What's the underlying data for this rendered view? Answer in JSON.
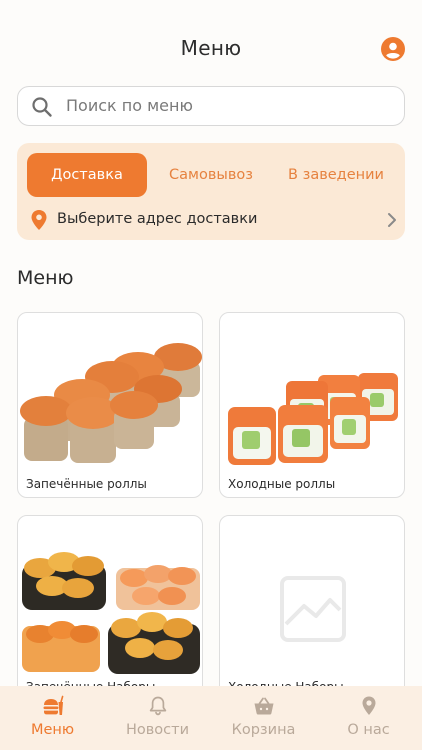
{
  "header": {
    "title": "Меню"
  },
  "search": {
    "placeholder": "Поиск по меню",
    "value": ""
  },
  "delivery": {
    "tabs": [
      {
        "label": "Доставка",
        "active": true
      },
      {
        "label": "Самовывоз",
        "active": false
      },
      {
        "label": "В заведении",
        "active": false
      }
    ],
    "address_prompt": "Выберите адрес доставки"
  },
  "menu": {
    "title": "Меню",
    "categories": [
      {
        "label": "Запечённые роллы",
        "icon": "baked-rolls-image"
      },
      {
        "label": "Холодные роллы",
        "icon": "cold-rolls-image"
      },
      {
        "label": "Запечённые Наборы",
        "icon": "baked-sets-image"
      },
      {
        "label": "Холодные Наборы",
        "icon": "image-placeholder-icon"
      }
    ]
  },
  "nav": {
    "items": [
      {
        "label": "Меню",
        "icon": "burger-drink-icon",
        "active": true
      },
      {
        "label": "Новости",
        "icon": "bell-icon",
        "active": false
      },
      {
        "label": "Корзина",
        "icon": "basket-icon",
        "active": false
      },
      {
        "label": "О нас",
        "icon": "location-pin-icon",
        "active": false
      }
    ]
  },
  "colors": {
    "accent": "#ee7a30",
    "card_bg": "#fbe9d6",
    "nav_bg": "#fbefe3",
    "inactive": "#b9a99a"
  }
}
